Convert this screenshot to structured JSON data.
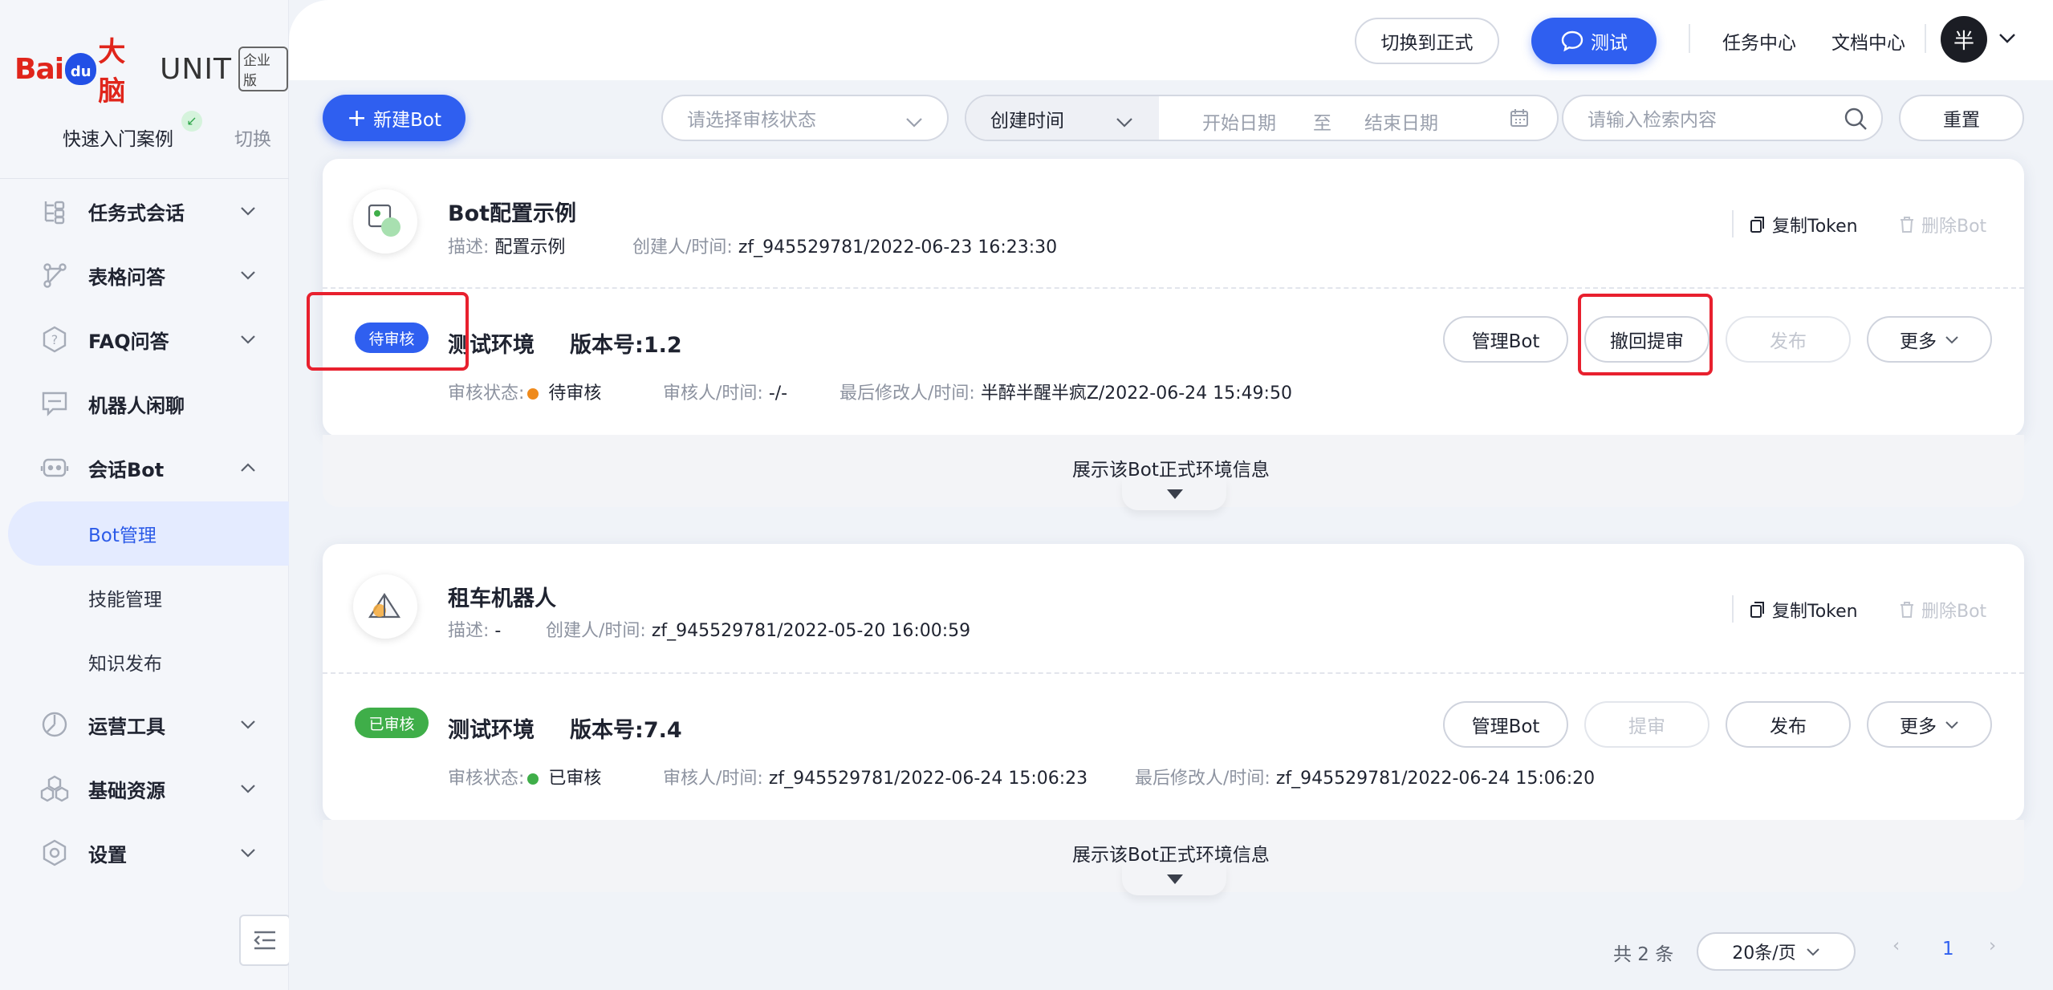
{
  "logo": {
    "brand_a": "Bai",
    "brand_paw": "du",
    "brand_b": "大脑",
    "unit": "UNIT",
    "edition": "企业版"
  },
  "sidebar": {
    "quick_start": "快速入门案例",
    "switch": "切换",
    "items": [
      {
        "label": "任务式会话",
        "icon": "task-dialog-icon",
        "expanded": false
      },
      {
        "label": "表格问答",
        "icon": "table-qa-icon",
        "expanded": false
      },
      {
        "label": "FAQ问答",
        "icon": "faq-icon",
        "expanded": false
      },
      {
        "label": "机器人闲聊",
        "icon": "chat-icon"
      },
      {
        "label": "会话Bot",
        "icon": "robot-icon",
        "expanded": true
      },
      {
        "label": "运营工具",
        "icon": "ops-icon",
        "expanded": false
      },
      {
        "label": "基础资源",
        "icon": "resource-icon",
        "expanded": false
      },
      {
        "label": "设置",
        "icon": "settings-icon",
        "expanded": false
      }
    ],
    "sub_items": [
      "Bot管理",
      "技能管理",
      "知识发布"
    ],
    "active_sub": "Bot管理"
  },
  "topbar": {
    "switch_prod": "切换到正式",
    "test": "测试",
    "task_center": "任务中心",
    "doc_center": "文档中心",
    "avatar": "半"
  },
  "filters": {
    "new_bot": "新建Bot",
    "review_placeholder": "请选择审核状态",
    "sort_field": "创建时间",
    "start_date": "开始日期",
    "to": "至",
    "end_date": "结束日期",
    "search_placeholder": "请输入检索内容",
    "reset": "重置"
  },
  "bots": [
    {
      "name": "Bot配置示例",
      "desc_label": "描述:",
      "desc": "配置示例",
      "creator_label": "创建人/时间:",
      "creator": "zf_945529781/2022-06-23 16:23:30",
      "copy_token": "复制Token",
      "delete_bot": "删除Bot",
      "badge": "待审核",
      "env": "测试环境",
      "version_label": "版本号:",
      "version": "1.2",
      "status_label": "审核状态:",
      "status": "待审核",
      "reviewer_label": "审核人/时间:",
      "reviewer": "-/-",
      "modifier_label": "最后修改人/时间:",
      "modifier": "半醉半醒半疯Z/2022-06-24 15:49:50",
      "btn_manage": "管理Bot",
      "btn_review": "撤回提审",
      "btn_publish": "发布",
      "btn_more": "更多",
      "footer": "展示该Bot正式环境信息"
    },
    {
      "name": "租车机器人",
      "desc_label": "描述:",
      "desc": "-",
      "creator_label": "创建人/时间:",
      "creator": "zf_945529781/2022-05-20 16:00:59",
      "copy_token": "复制Token",
      "delete_bot": "删除Bot",
      "badge": "已审核",
      "env": "测试环境",
      "version_label": "版本号:",
      "version": "7.4",
      "status_label": "审核状态:",
      "status": "已审核",
      "reviewer_label": "审核人/时间:",
      "reviewer": "zf_945529781/2022-06-24 15:06:23",
      "modifier_label": "最后修改人/时间:",
      "modifier": "zf_945529781/2022-06-24 15:06:20",
      "btn_manage": "管理Bot",
      "btn_review": "提审",
      "btn_publish": "发布",
      "btn_more": "更多",
      "footer": "展示该Bot正式环境信息"
    }
  ],
  "pagination": {
    "total": "共 2 条",
    "page_size": "20条/页",
    "current_page": "1"
  },
  "colors": {
    "primary": "#2f5ff0",
    "pending": "#ef8a1b",
    "approved": "#3fae49",
    "highlight": "#e8202e"
  }
}
